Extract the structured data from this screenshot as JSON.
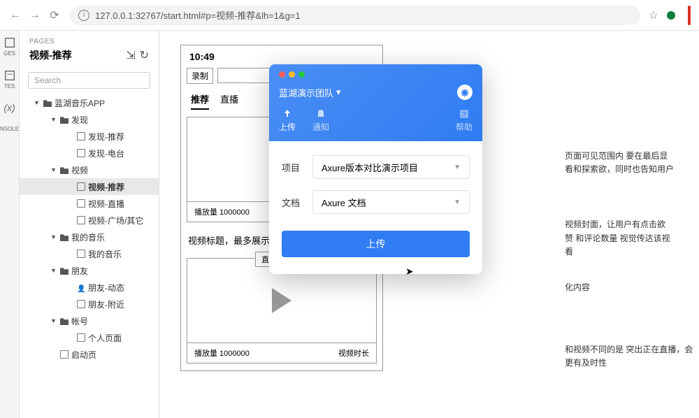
{
  "browser": {
    "url": "127.0.0.1:32767/start.html#p=视频-推荐&lh=1&g=1"
  },
  "rail": {
    "items": [
      "GES",
      "TES",
      "(x)",
      "NSOLE"
    ]
  },
  "sidebar": {
    "pages_label": "PAGES",
    "title": "视频-推荐",
    "search_placeholder": "Search",
    "tree": [
      {
        "label": "蓝湖音乐APP",
        "type": "folder",
        "lvl": 1,
        "caret": "▼"
      },
      {
        "label": "发现",
        "type": "folder",
        "lvl": 2,
        "caret": "▼"
      },
      {
        "label": "发现-推荐",
        "type": "page",
        "lvl": 3
      },
      {
        "label": "发现-电台",
        "type": "page",
        "lvl": 3
      },
      {
        "label": "视频",
        "type": "folder",
        "lvl": 2,
        "caret": "▼"
      },
      {
        "label": "视频-推荐",
        "type": "page",
        "lvl": 3,
        "selected": true
      },
      {
        "label": "视频-直播",
        "type": "page",
        "lvl": 3
      },
      {
        "label": "视频-广场/其它",
        "type": "page",
        "lvl": 3
      },
      {
        "label": "我的音乐",
        "type": "folder",
        "lvl": 2,
        "caret": "▼"
      },
      {
        "label": "我的音乐",
        "type": "page",
        "lvl": 3
      },
      {
        "label": "朋友",
        "type": "folder",
        "lvl": 2,
        "caret": "▼"
      },
      {
        "label": "朋友-动态",
        "type": "person",
        "lvl": 3
      },
      {
        "label": "朋友-附近",
        "type": "page",
        "lvl": 3
      },
      {
        "label": "帐号",
        "type": "folder",
        "lvl": 2,
        "caret": "▼"
      },
      {
        "label": "个人页面",
        "type": "page",
        "lvl": 3
      },
      {
        "label": "启动页",
        "type": "page",
        "lvl": 2
      }
    ]
  },
  "phone": {
    "time": "10:49",
    "rec_btn": "录制",
    "tabs": [
      "推荐",
      "直播"
    ],
    "card1": {
      "plays": "播放量 1000000",
      "title": "视频标题，最多展示"
    },
    "card2": {
      "live_badge": "直播中 图标",
      "plays": "播放量 1000000",
      "duration": "视频时长"
    }
  },
  "annotations": {
    "a1": "页面可见范围内 要在最后显",
    "a2": "看和探索欲，同时也告知用户",
    "a3": "视频封面，让用户有点击欲",
    "a4": "赞 和评论数量 视觉传达该视",
    "a5": "看",
    "a6": "化内容",
    "a7": "和视频不同的是 突出正在直播，会更有及时性"
  },
  "modal": {
    "team": "蓝湖演示团队",
    "tab_upload": "上传",
    "tab_notify": "通知",
    "tab_help": "帮助",
    "project_label": "项目",
    "project_value": "Axure版本对比演示项目",
    "doc_label": "文档",
    "doc_value": "Axure 文档",
    "upload_btn": "上传"
  }
}
